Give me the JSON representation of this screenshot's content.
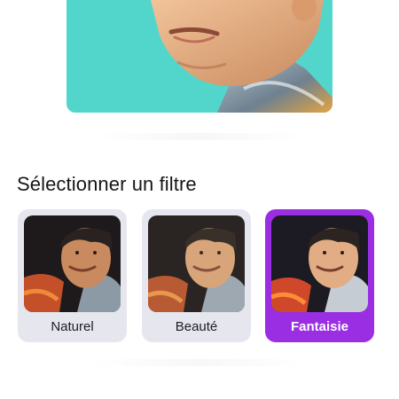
{
  "preview": {
    "background_color": "#52d6cb",
    "image_icon": "portrait-preview-image"
  },
  "filters_section": {
    "title": "Sélectionner un filtre",
    "selected_index": 2,
    "accent_color": "#9a2ee3",
    "items": [
      {
        "label": "Naturel",
        "selected": false
      },
      {
        "label": "Beauté",
        "selected": false
      },
      {
        "label": "Fantaisie",
        "selected": true
      }
    ]
  }
}
